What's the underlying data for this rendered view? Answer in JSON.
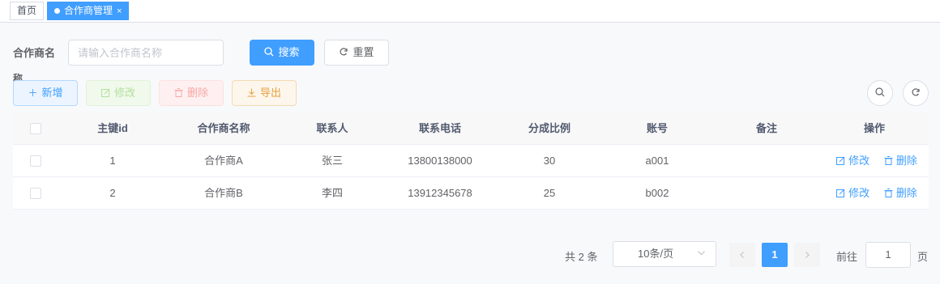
{
  "tags": {
    "home": "首页",
    "active": "合作商管理",
    "close": "×"
  },
  "search": {
    "label_line1": "合作商名",
    "label_line2": "称",
    "placeholder": "请输入合作商名称",
    "search_label": "搜索",
    "reset_label": "重置"
  },
  "toolbar": {
    "add_label": "新增",
    "edit_label": "修改",
    "delete_label": "删除",
    "export_label": "导出"
  },
  "table": {
    "headers": [
      "主键id",
      "合作商名称",
      "联系人",
      "联系电话",
      "分成比例",
      "账号",
      "备注",
      "操作"
    ],
    "rows": [
      {
        "id": "1",
        "name": "合作商A",
        "contact": "张三",
        "phone": "13800138000",
        "ratio": "30",
        "account": "a001",
        "note": ""
      },
      {
        "id": "2",
        "name": "合作商B",
        "contact": "李四",
        "phone": "13912345678",
        "ratio": "25",
        "account": "b002",
        "note": ""
      }
    ],
    "op_edit": "修改",
    "op_delete": "删除"
  },
  "pagination": {
    "total": "共 2 条",
    "page_size": "10条/页",
    "current_page": "1",
    "goto_label": "前往",
    "goto_value": "1",
    "goto_suffix": "页"
  },
  "colors": {
    "primary": "#409eff",
    "success_light": "#f0f9eb",
    "danger_light": "#fef0f0",
    "warning": "#e6a23c"
  }
}
